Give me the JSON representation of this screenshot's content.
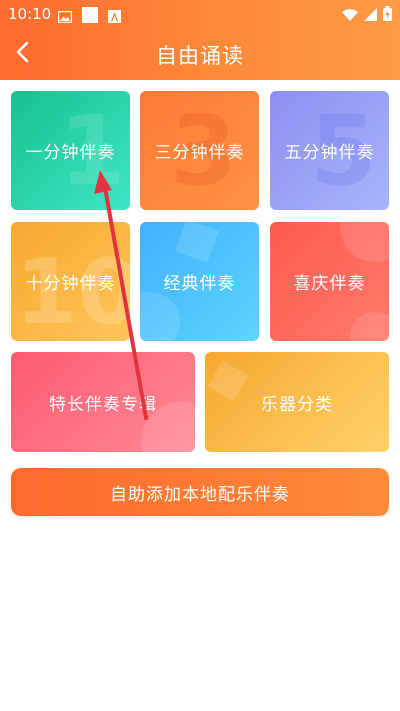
{
  "status": {
    "time": "10:10",
    "icons": [
      "image-icon",
      "square-icon",
      "a-icon",
      "wifi-icon",
      "signal-icon",
      "battery-icon"
    ]
  },
  "header": {
    "back_icon": "chevron-left-icon",
    "title": "自由诵读"
  },
  "tiles": [
    {
      "label": "一分钟伴奏",
      "number": "1",
      "color": "#20c79b"
    },
    {
      "label": "三分钟伴奏",
      "number": "3",
      "color": "#ff7e38"
    },
    {
      "label": "五分钟伴奏",
      "number": "5",
      "color": "#959cf3"
    },
    {
      "label": "十分钟伴奏",
      "number": "10",
      "color": "#f9b340"
    },
    {
      "label": "经典伴奏",
      "number": "",
      "color": "#45bdfd"
    },
    {
      "label": "喜庆伴奏",
      "number": "",
      "color": "#ff625a"
    },
    {
      "label": "特长伴奏专辑",
      "number": "",
      "color": "#ff6a7d"
    },
    {
      "label": "乐器分类",
      "number": "",
      "color": "#f8bb46"
    }
  ],
  "add_button": {
    "label": "自助添加本地配乐伴奏"
  },
  "annotation": {
    "type": "red-arrow",
    "color": "#e0353f"
  }
}
